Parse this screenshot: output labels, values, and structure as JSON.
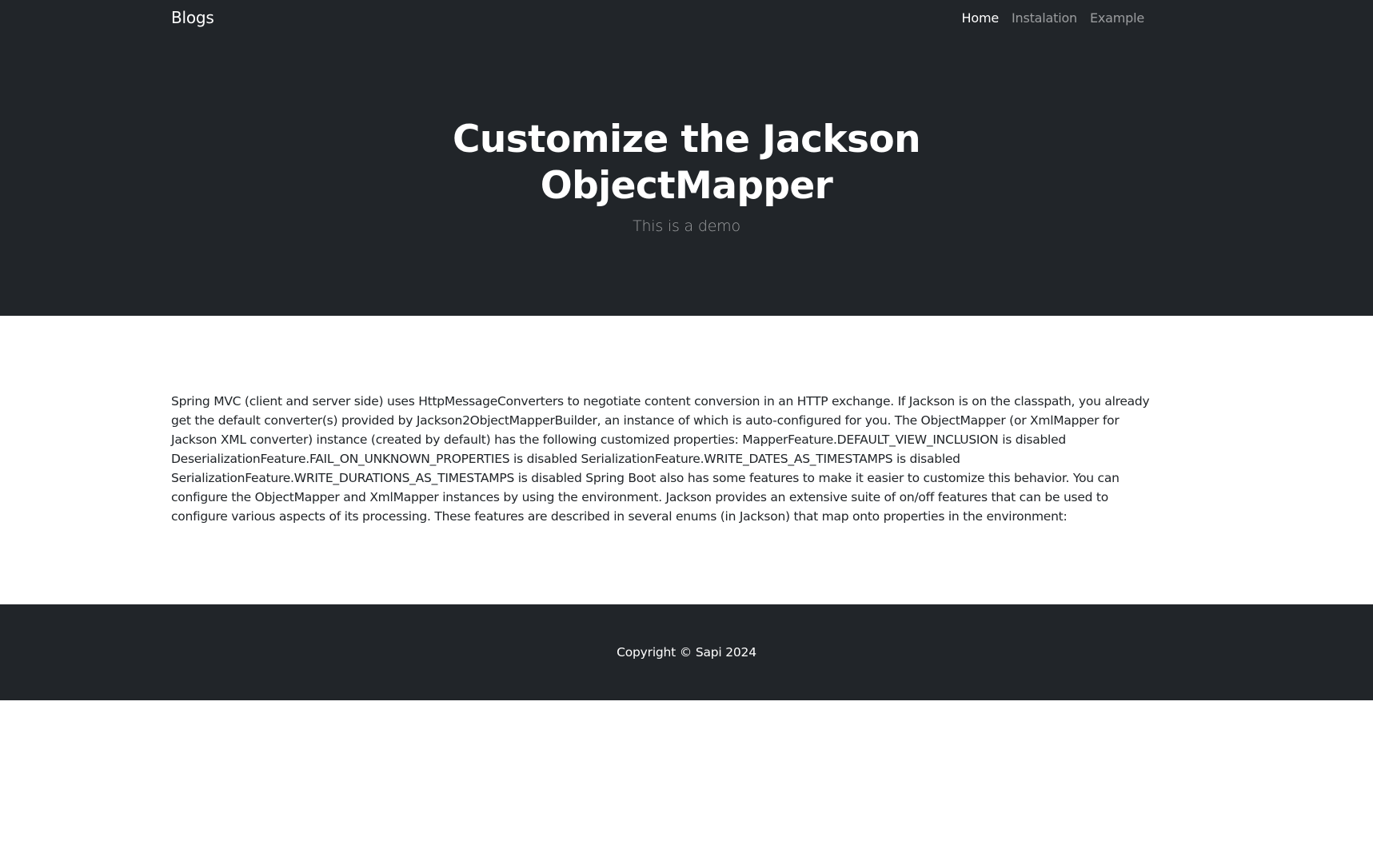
{
  "navbar": {
    "brand": "Blogs",
    "links": [
      {
        "label": "Home",
        "active": true
      },
      {
        "label": "Instalation",
        "active": false
      },
      {
        "label": "Example",
        "active": false
      }
    ]
  },
  "hero": {
    "title_line1": "Customize the Jackson",
    "title_line2": "ObjectMapper",
    "subtitle": "This is a demo"
  },
  "main": {
    "body": "Spring MVC (client and server side) uses HttpMessageConverters to negotiate content conversion in an HTTP exchange. If Jackson is on the classpath, you already get the default converter(s) provided by Jackson2ObjectMapperBuilder, an instance of which is auto-configured for you. The ObjectMapper (or XmlMapper for Jackson XML converter) instance (created by default) has the following customized properties: MapperFeature.DEFAULT_VIEW_INCLUSION is disabled DeserializationFeature.FAIL_ON_UNKNOWN_PROPERTIES is disabled SerializationFeature.WRITE_DATES_AS_TIMESTAMPS is disabled SerializationFeature.WRITE_DURATIONS_AS_TIMESTAMPS is disabled Spring Boot also has some features to make it easier to customize this behavior. You can configure the ObjectMapper and XmlMapper instances by using the environment. Jackson provides an extensive suite of on/off features that can be used to configure various aspects of its processing. These features are described in several enums (in Jackson) that map onto properties in the environment:"
  },
  "footer": {
    "copyright": "Copyright © Sapi 2024"
  },
  "colors": {
    "dark_bg": "#212529",
    "text_light": "#ffffff",
    "text_muted": "rgba(255,255,255,0.55)",
    "body_text": "#212529"
  }
}
